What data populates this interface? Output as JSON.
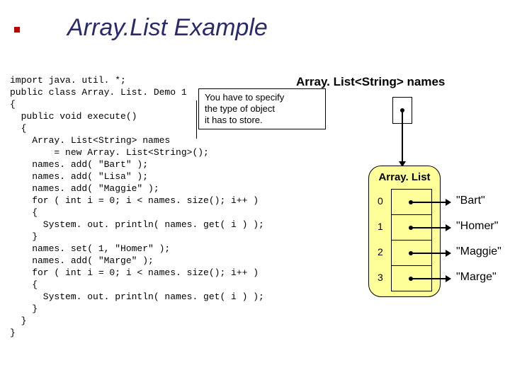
{
  "title": "Array.List Example",
  "code": "import java. util. *;\npublic class Array. List. Demo 1\n{\n  public void execute()\n  {\n    Array. List<String> names\n        = new Array. List<String>();\n    names. add( \"Bart\" );\n    names. add( \"Lisa\" );\n    names. add( \"Maggie\" );\n    for ( int i = 0; i < names. size(); i++ )\n    {\n      System. out. println( names. get( i ) );\n    }\n    names. set( 1, \"Homer\" );\n    names. add( \"Marge\" );\n    for ( int i = 0; i < names. size(); i++ )\n    {\n      System. out. println( names. get( i ) );\n    }\n  }\n}",
  "callout_line1": "You have to specify",
  "callout_line2": "the type of object",
  "callout_line3": "it has to store.",
  "var_label": "Array. List<String> names",
  "arraylist_label": "Array. List",
  "cells": [
    {
      "index": "0",
      "value": "\"Bart\""
    },
    {
      "index": "1",
      "value": "\"Homer\""
    },
    {
      "index": "2",
      "value": "\"Maggie\""
    },
    {
      "index": "3",
      "value": "\"Marge\""
    }
  ]
}
